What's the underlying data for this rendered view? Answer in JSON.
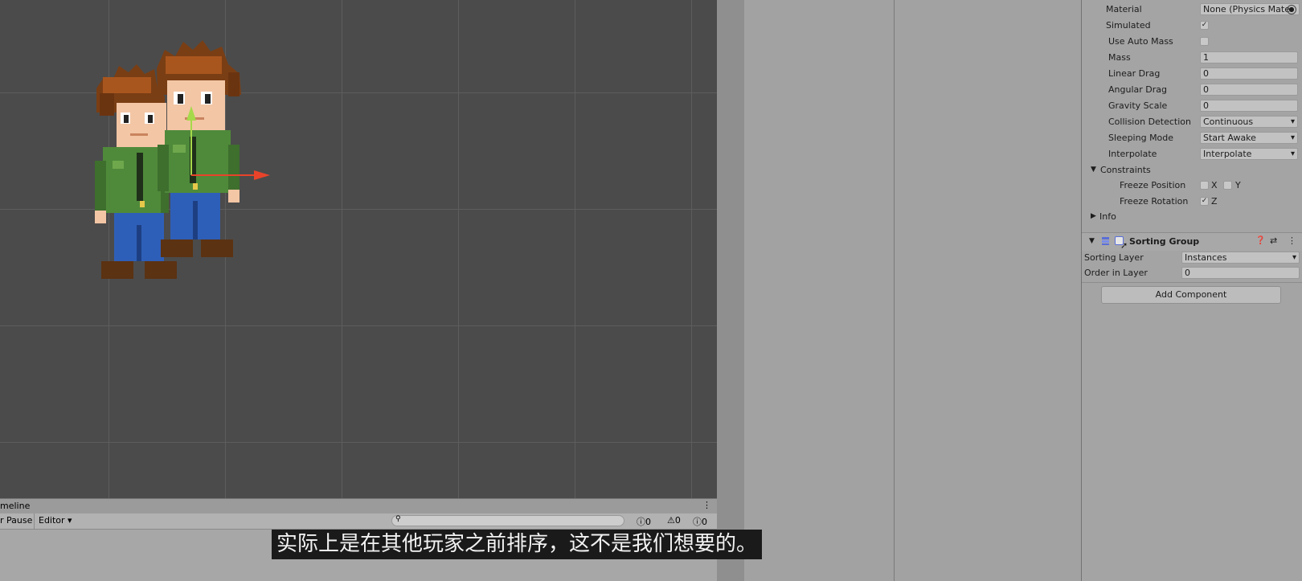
{
  "inspector": {
    "rigidbody": {
      "material_label": "Material",
      "material_value": "None (Physics Mate",
      "simulated_label": "Simulated",
      "simulated_checked": true,
      "use_auto_mass_label": "Use Auto Mass",
      "use_auto_mass_checked": false,
      "mass_label": "Mass",
      "mass_value": "1",
      "linear_drag_label": "Linear Drag",
      "linear_drag_value": "0",
      "angular_drag_label": "Angular Drag",
      "angular_drag_value": "0",
      "gravity_scale_label": "Gravity Scale",
      "gravity_scale_value": "0",
      "collision_detection_label": "Collision Detection",
      "collision_detection_value": "Continuous",
      "sleeping_mode_label": "Sleeping Mode",
      "sleeping_mode_value": "Start Awake",
      "interpolate_label": "Interpolate",
      "interpolate_value": "Interpolate",
      "constraints_label": "Constraints",
      "freeze_position_label": "Freeze Position",
      "freeze_position_x_label": "X",
      "freeze_position_x_checked": false,
      "freeze_position_y_label": "Y",
      "freeze_position_y_checked": false,
      "freeze_rotation_label": "Freeze Rotation",
      "freeze_rotation_z_label": "Z",
      "freeze_rotation_z_checked": true,
      "info_label": "Info"
    },
    "sorting_group": {
      "title": "Sorting Group",
      "enabled": false,
      "sorting_layer_label": "Sorting Layer",
      "sorting_layer_value": "Instances",
      "order_in_layer_label": "Order in Layer",
      "order_in_layer_value": "0"
    },
    "add_component_label": "Add Component"
  },
  "bottom_panel": {
    "tab_label": "meline",
    "pause_label": "r Pause",
    "editor_dropdown": "Editor",
    "log_count": "0",
    "warning_count": "0",
    "error_count": "0"
  },
  "subtitle": "实际上是在其他玩家之前排序，这不是我们想要的。",
  "colors": {
    "scene_bg": "#4b4b4b",
    "inspector_bg": "#a4a4a4",
    "arrow_red": "#e8432a",
    "arrow_green": "#a6d94a",
    "icon_blue": "#5b6fd8"
  }
}
